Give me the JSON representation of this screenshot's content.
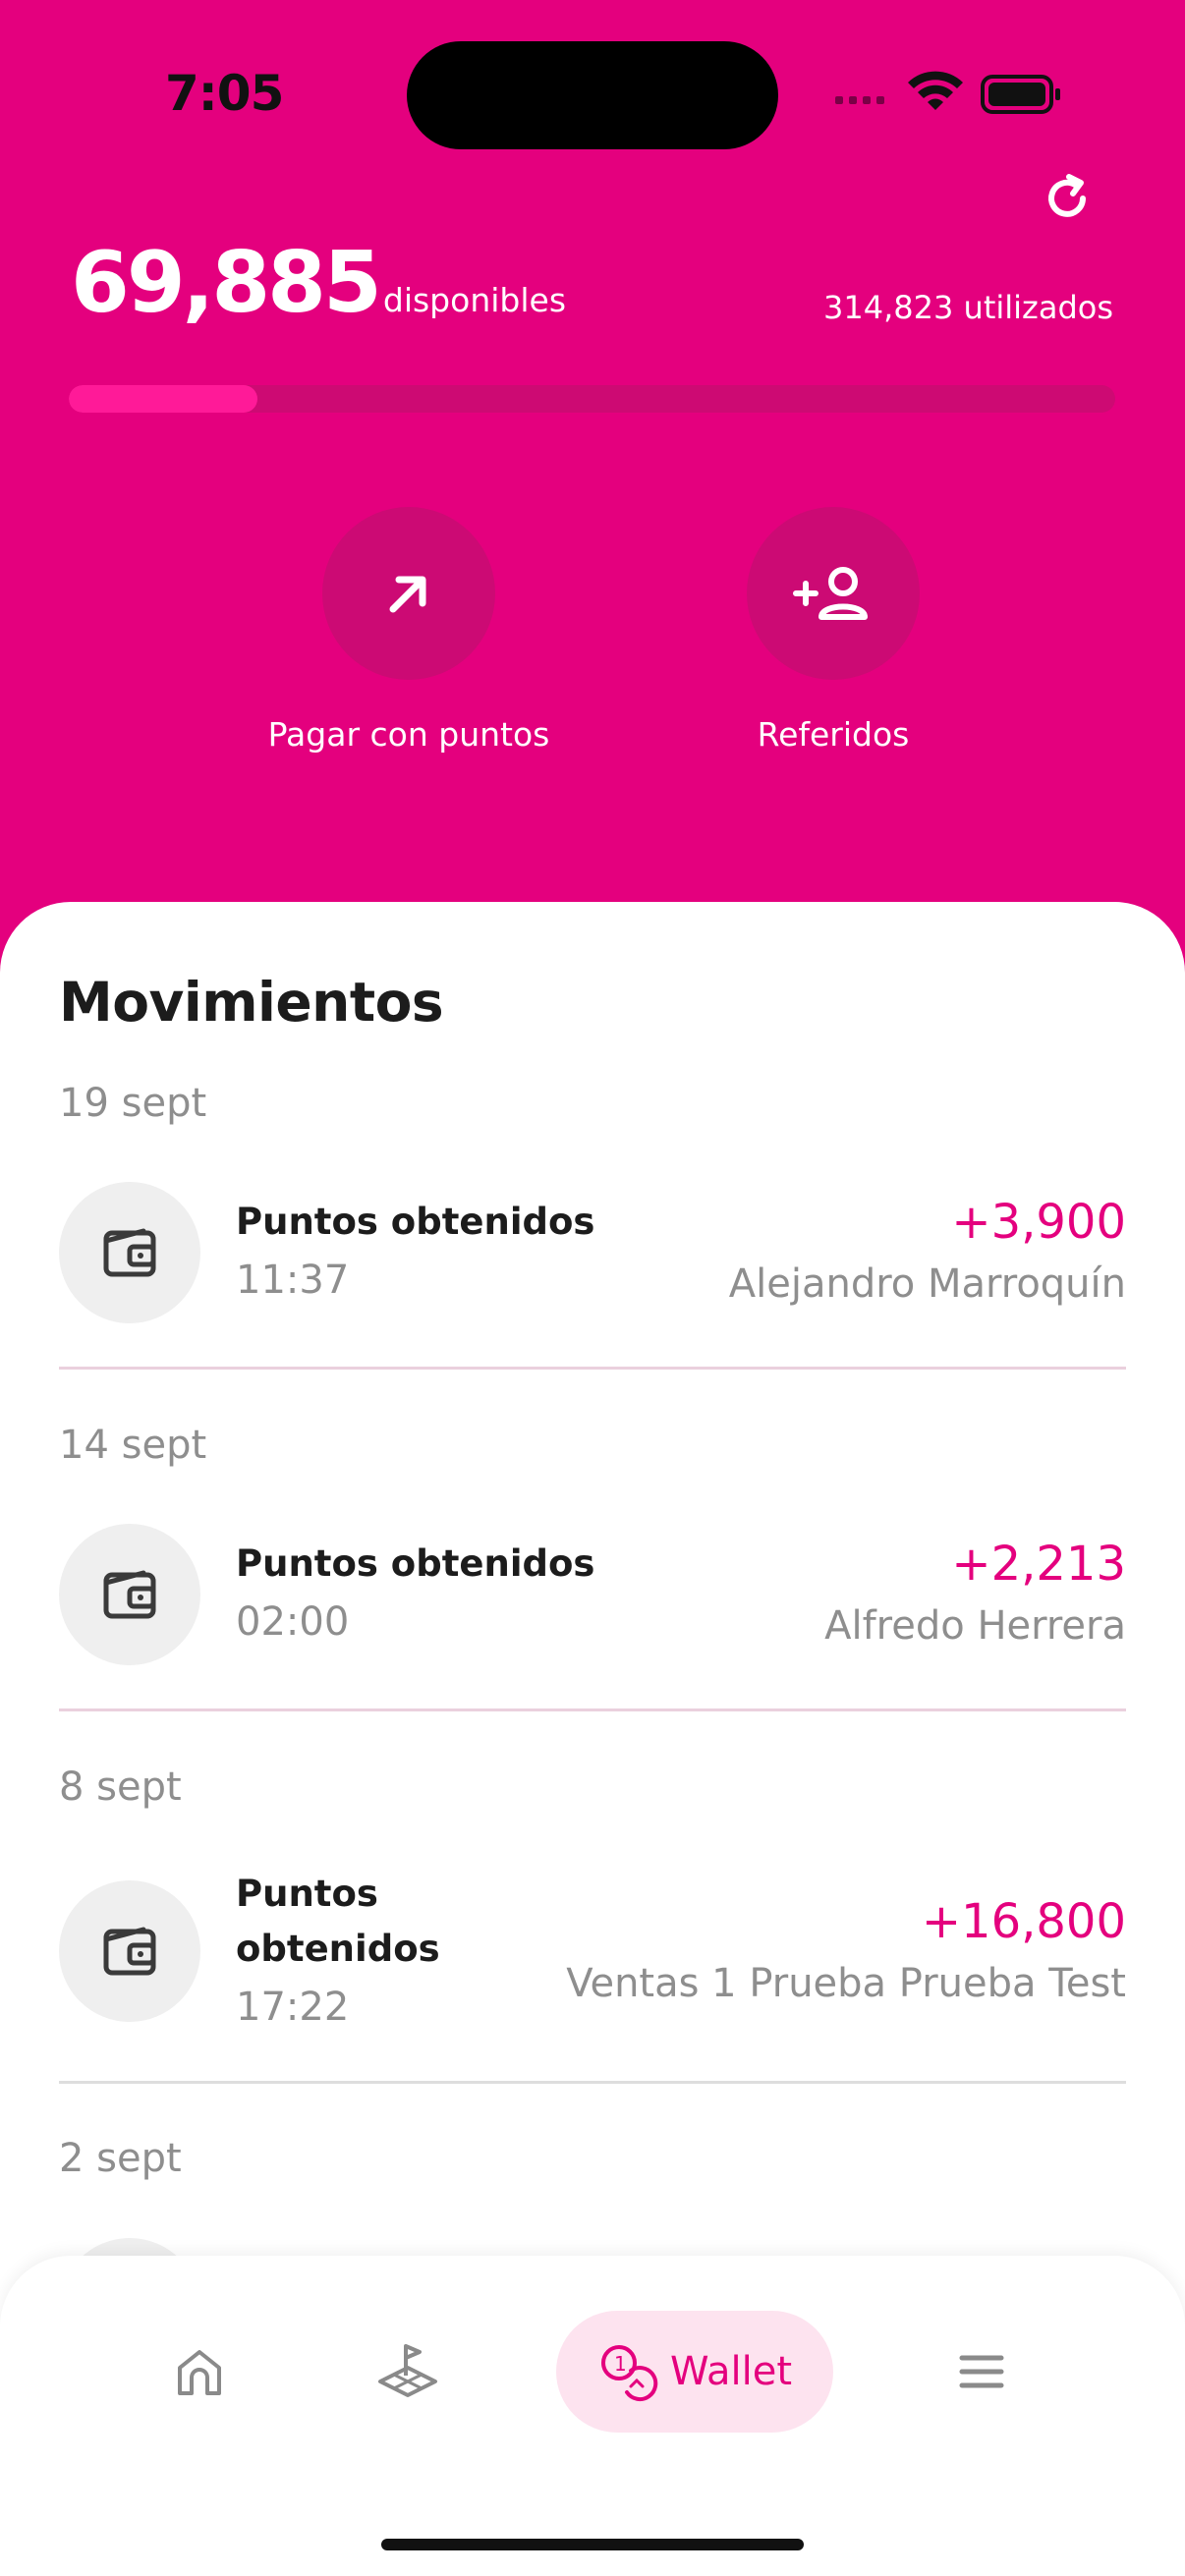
{
  "status_bar": {
    "time": "7:05"
  },
  "summary": {
    "available_points": "69,885",
    "available_label": "disponibles",
    "used_text": "314,823 utilizados",
    "progress_fraction": 0.18
  },
  "actions": [
    {
      "label": "Pagar con puntos",
      "icon": "arrow-up-right-icon"
    },
    {
      "label": "Referidos",
      "icon": "add-person-icon"
    }
  ],
  "movements": {
    "title": "Movimientos",
    "groups": [
      {
        "date": "19 sept",
        "item": {
          "title": "Puntos obtenidos",
          "time": "11:37",
          "amount": "+3,900",
          "name": "Alejandro Marroquín"
        }
      },
      {
        "date": "14 sept",
        "item": {
          "title": "Puntos obtenidos",
          "time": "02:00",
          "amount": "+2,213",
          "name": "Alfredo Herrera"
        }
      },
      {
        "date": "8 sept",
        "item": {
          "title": "Puntos obtenidos",
          "time": "17:22",
          "amount": "+16,800",
          "name": "Ventas 1 Prueba Prueba Test"
        }
      },
      {
        "date": "2 sept"
      }
    ]
  },
  "bottom_nav": {
    "items": [
      {
        "icon": "home-icon"
      },
      {
        "icon": "golf-flag-icon"
      },
      {
        "icon": "coins-icon",
        "label": "Wallet",
        "active": true
      },
      {
        "icon": "menu-icon"
      }
    ]
  },
  "colors": {
    "brand": "#e4007e",
    "active_pill": "#fde3ef"
  }
}
